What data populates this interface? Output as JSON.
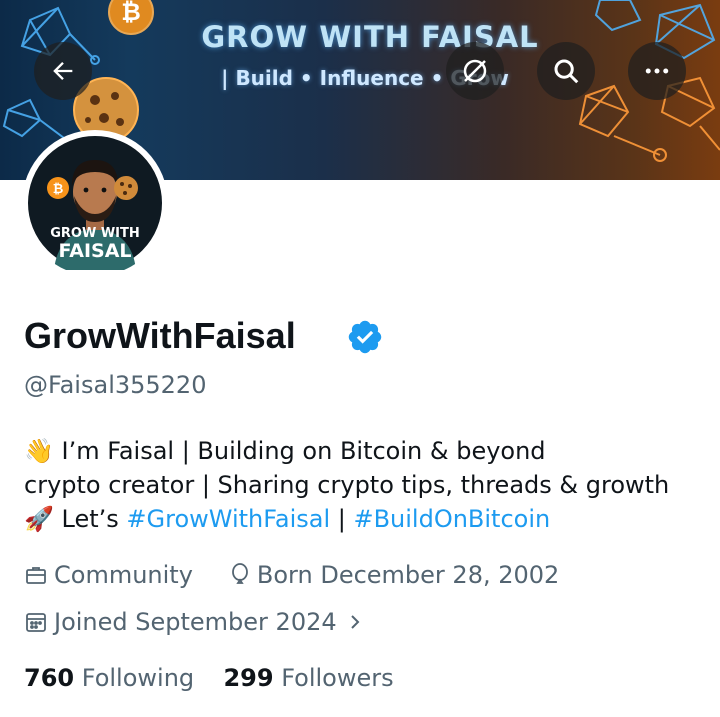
{
  "banner": {
    "title": "GROW WITH FAISAL",
    "subtitle": "| Build • Influence • Grow"
  },
  "header_actions": {
    "back_icon": "arrow-left-icon",
    "action_icon": "slashed-circle-icon",
    "search_icon": "search-icon",
    "more_icon": "more-horizontal-icon"
  },
  "avatar": {
    "label_line1": "GROW WITH",
    "label_line2": "FAISAL"
  },
  "profile": {
    "display_name": "GrowWithFaisal",
    "handle": "@Faisal355220",
    "verified_color": "#1d9bf0",
    "bio": {
      "line1": "👋 I’m Faisal | Building on Bitcoin & beyond",
      "line2": "crypto creator | Sharing crypto tips, threads & growth",
      "line3_prefix": "🚀 Let’s ",
      "hashtag1": "#GrowWithFaisal",
      "separator": " | ",
      "hashtag2": "#BuildOnBitcoin"
    },
    "category": "Community",
    "birthday": "Born December 28, 2002",
    "joined": "Joined September 2024",
    "following_count": "760",
    "following_label": "Following",
    "followers_count": "299",
    "followers_label": "Followers"
  },
  "colors": {
    "accent": "#1d9bf0",
    "text_primary": "#0f1419",
    "text_secondary": "#536471"
  }
}
